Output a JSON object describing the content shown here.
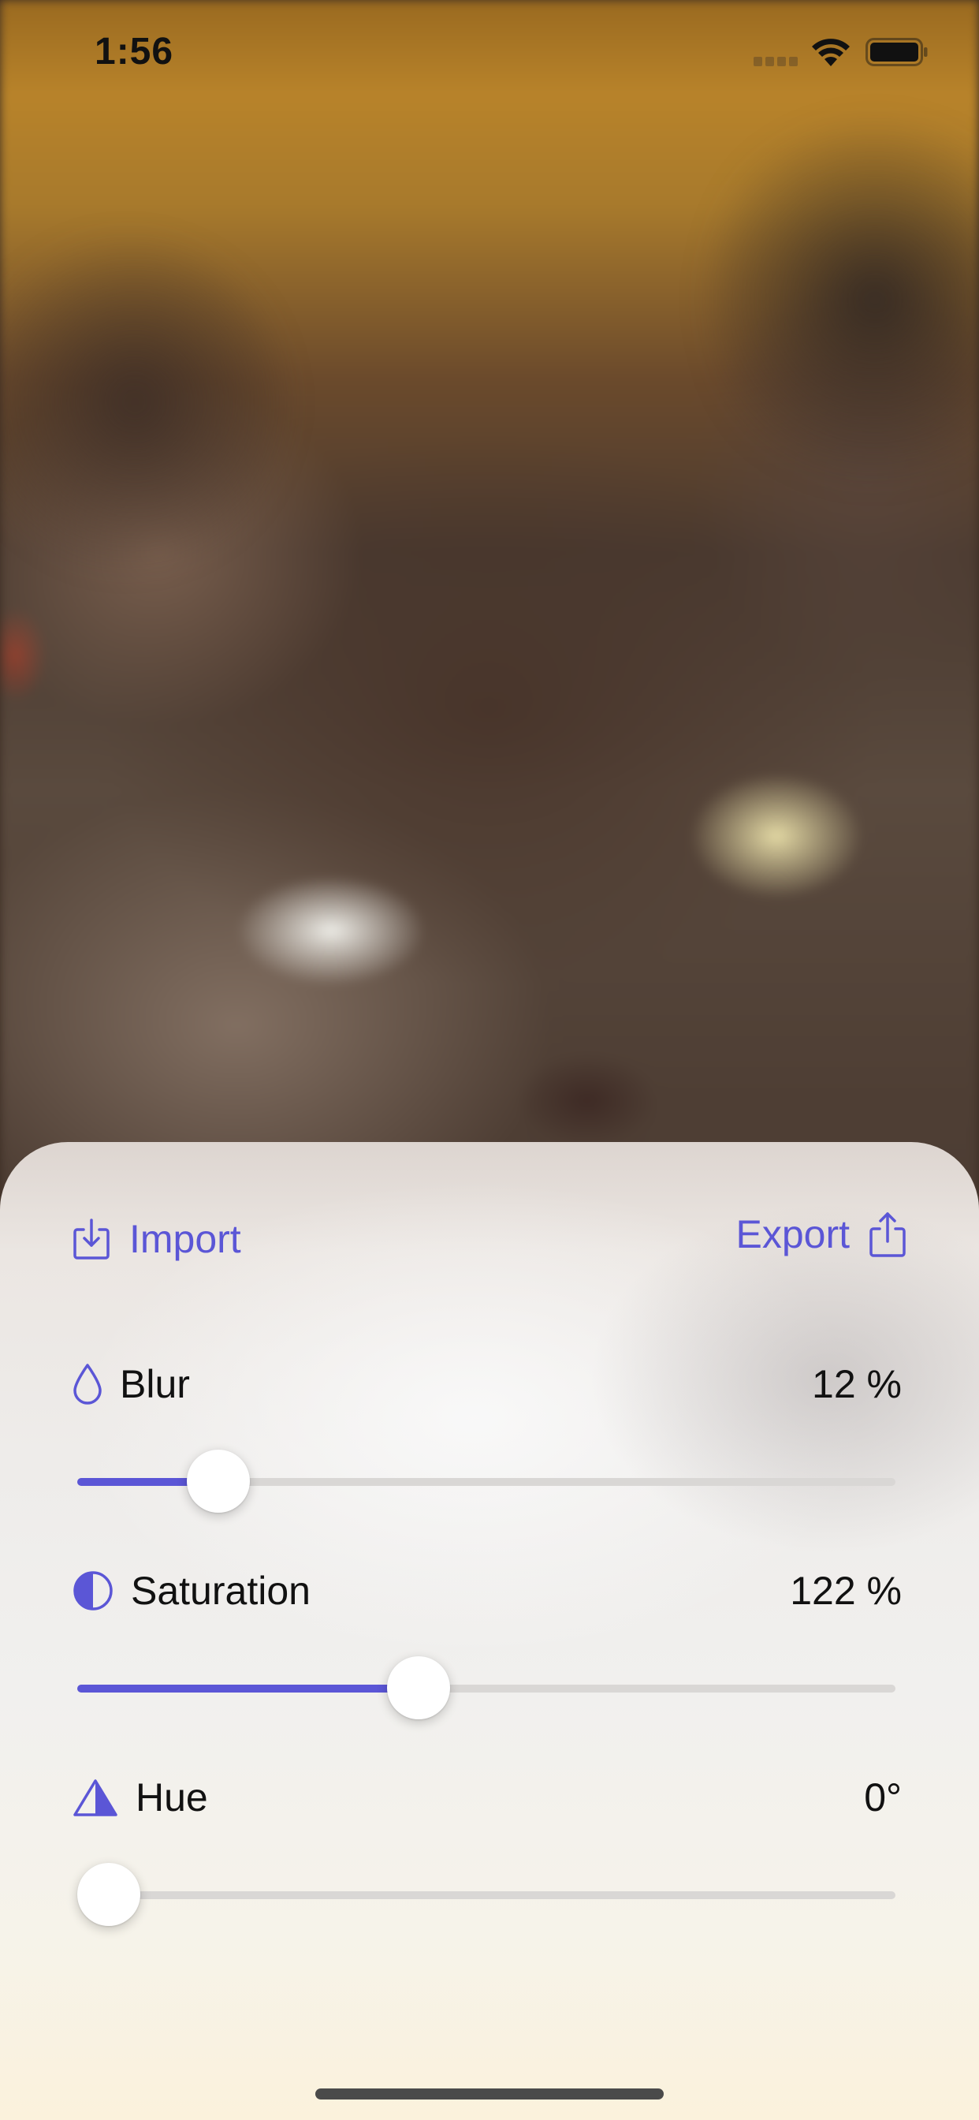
{
  "status_bar": {
    "time": "1:56"
  },
  "toolbar": {
    "import_label": "Import",
    "export_label": "Export"
  },
  "colors": {
    "accent": "#5b56d6",
    "track": "#d9d7d5",
    "text": "#111111"
  },
  "controls": [
    {
      "label": "Blur",
      "value_text": "12 %",
      "icon": "drop-icon",
      "slider_fraction": 0.145
    },
    {
      "label": "Saturation",
      "value_text": "122 %",
      "icon": "contrast-icon",
      "slider_fraction": 0.41
    },
    {
      "label": "Hue",
      "value_text": "0°",
      "icon": "hue-triangle-icon",
      "slider_fraction": 0.0
    }
  ]
}
